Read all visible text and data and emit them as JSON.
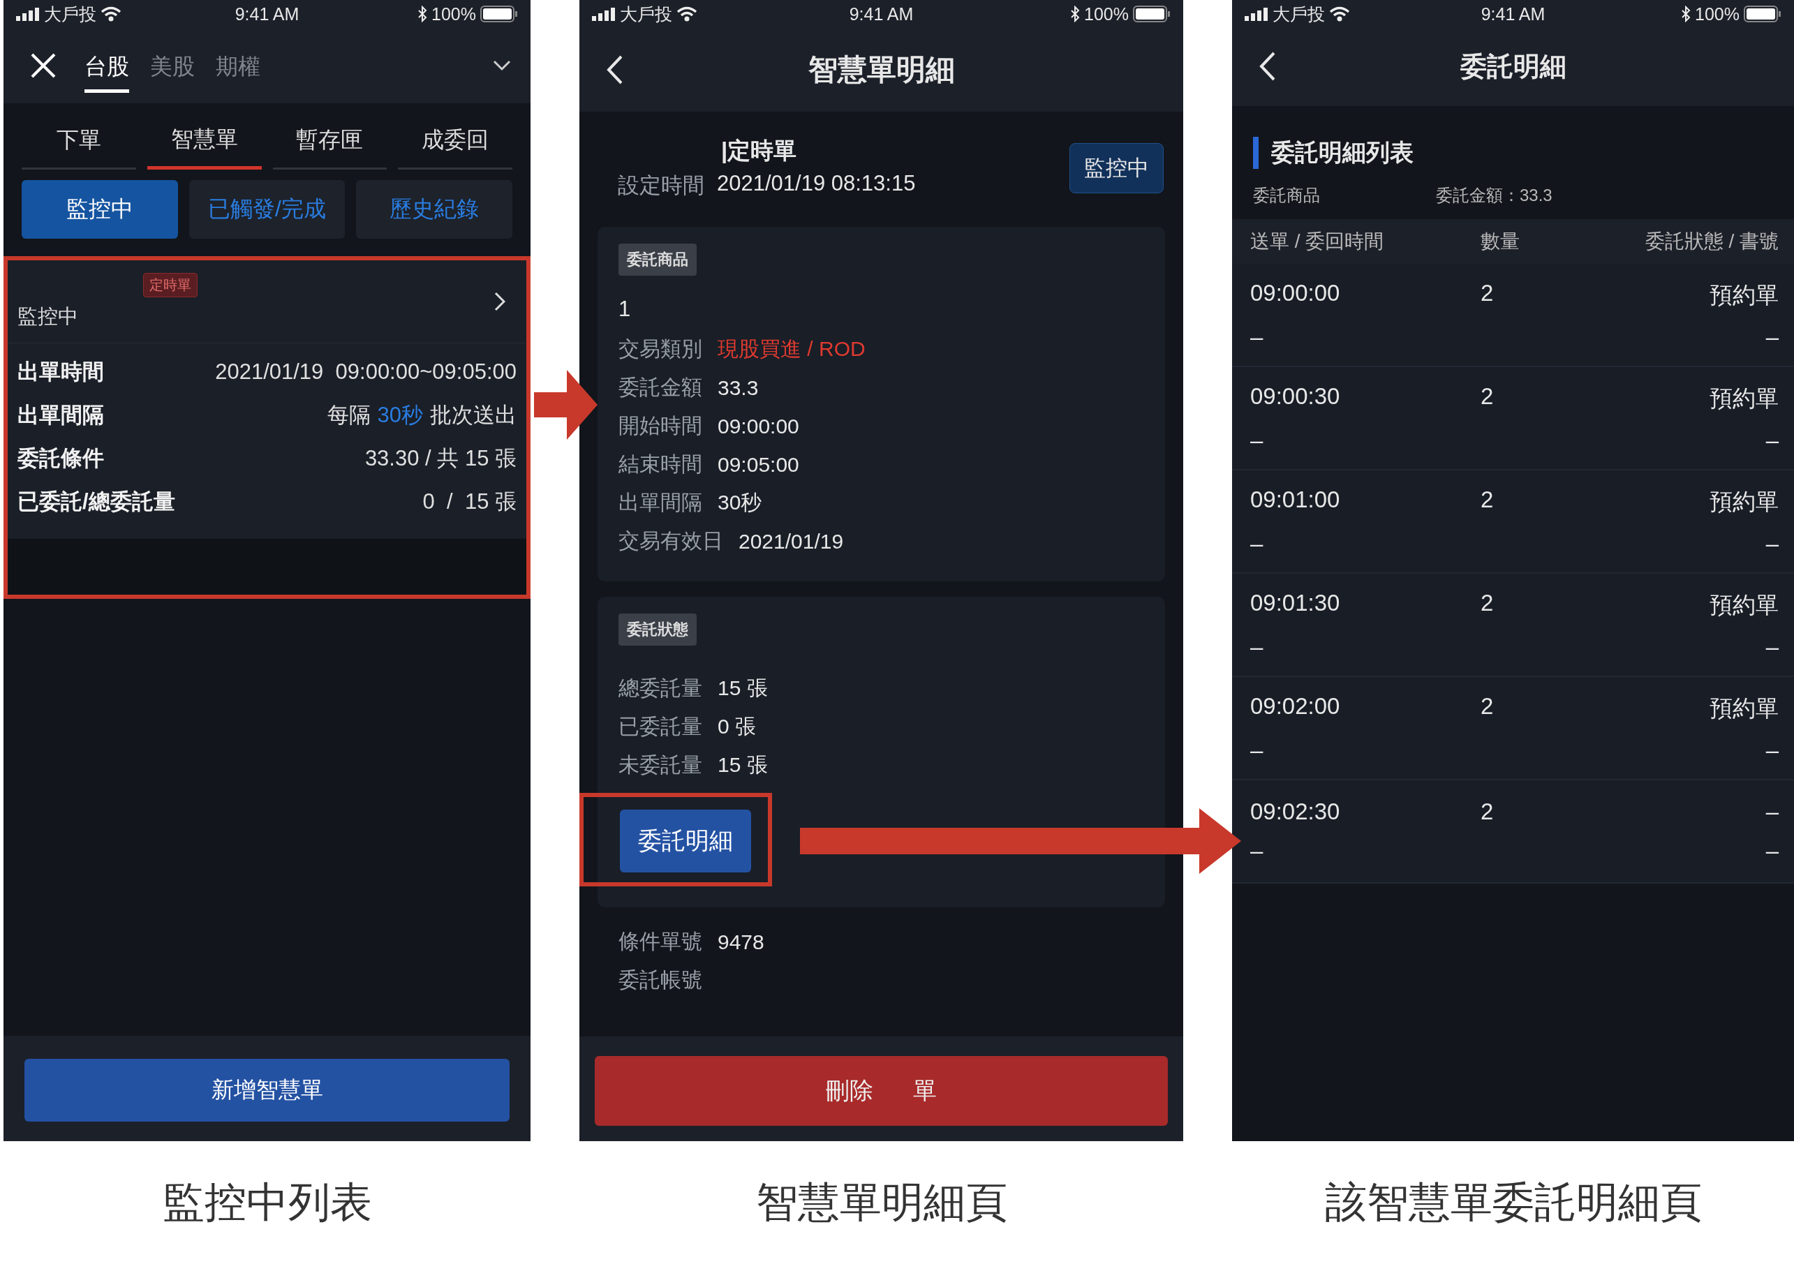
{
  "list_screen": {
    "status_bar": {
      "carrier": "大戶投",
      "time": "9:41 AM",
      "battery": "100%"
    },
    "market_tabs": [
      {
        "label": "台股",
        "selected": true
      },
      {
        "label": "美股",
        "selected": false
      },
      {
        "label": "期權",
        "selected": false
      }
    ],
    "order_tabs": [
      {
        "label": "下單",
        "selected": false
      },
      {
        "label": "智慧單",
        "selected": true
      },
      {
        "label": "暫存匣",
        "selected": false
      },
      {
        "label": "成委回",
        "selected": false
      }
    ],
    "filters": [
      {
        "label": "監控中",
        "selected": true
      },
      {
        "label": "已觸發/完成",
        "selected": false
      },
      {
        "label": "歷史紀錄",
        "selected": false
      }
    ],
    "order_card": {
      "badge": "定時單",
      "status": "監控中",
      "rows": [
        {
          "label": "出單時間",
          "value": "2021/01/19  09:00:00~09:05:00"
        },
        {
          "label": "出單間隔",
          "value": "每隔",
          "highlight": "30秒",
          "suffix": "批次送出"
        },
        {
          "label": "委託條件",
          "value": "33.30 / 共 15 張"
        },
        {
          "label": "已委託/總委託量",
          "value": "0  /  15 張"
        }
      ]
    },
    "add_button": "新增智慧單"
  },
  "detail_screen": {
    "status_bar": {
      "carrier": "大戶投",
      "time": "9:41 AM",
      "battery": "100%"
    },
    "title": "智慧單明細",
    "order_type": "|定時單",
    "set_time_label": "設定時間",
    "set_time": "2021/01/19 08:13:15",
    "status_badge": "監控中",
    "product_section": {
      "tag": "委託商品",
      "product": "1",
      "rows": [
        {
          "label": "交易類別",
          "value": "現股買進 / ROD",
          "kind": "alert"
        },
        {
          "label": "委託金額",
          "value": "33.3",
          "kind": "plain"
        },
        {
          "label": "開始時間",
          "value": "09:00:00",
          "kind": "plain"
        },
        {
          "label": "結束時間",
          "value": "09:05:00",
          "kind": "plain"
        },
        {
          "label": "出單間隔",
          "value": "30秒",
          "kind": "plain"
        },
        {
          "label": "交易有效日",
          "value": "2021/01/19",
          "kind": "plain"
        }
      ]
    },
    "status_section": {
      "tag": "委託狀態",
      "rows": [
        {
          "label": "總委託量",
          "value": "15 張"
        },
        {
          "label": "已委託量",
          "value": "0 張"
        },
        {
          "label": "未委託量",
          "value": "15 張"
        }
      ],
      "button": "委託明細"
    },
    "footer_rows": [
      {
        "label": "條件單號",
        "value": "9478"
      },
      {
        "label": "委託帳號"
      }
    ],
    "delete_button": "刪除      單"
  },
  "entrust_screen": {
    "status_bar": {
      "carrier": "大戶投",
      "time": "9:41 AM",
      "battery": "100%"
    },
    "title": "委託明細",
    "section_title": "委託明細列表",
    "product_label": "委託商品",
    "amount": "委託金額：33.3",
    "columns": [
      "送單 / 委回時間",
      "數量",
      "委託狀態 / 書號"
    ],
    "rows": [
      {
        "time": "09:00:00",
        "reply_time": "–",
        "quantity": "2",
        "status": "預約單",
        "book_no": "–"
      },
      {
        "time": "09:00:30",
        "reply_time": "–",
        "quantity": "2",
        "status": "預約單",
        "book_no": "–"
      },
      {
        "time": "09:01:00",
        "reply_time": "–",
        "quantity": "2",
        "status": "預約單",
        "book_no": "–"
      },
      {
        "time": "09:01:30",
        "reply_time": "–",
        "quantity": "2",
        "status": "預約單",
        "book_no": "–"
      },
      {
        "time": "09:02:00",
        "reply_time": "–",
        "quantity": "2",
        "status": "預約單",
        "book_no": "–"
      },
      {
        "time": "09:02:30",
        "reply_time": "–",
        "quantity": "2",
        "status": "–",
        "book_no": "–"
      }
    ]
  },
  "captions": [
    "監控中列表",
    "智慧單明細頁",
    "該智慧單委託明細頁"
  ]
}
